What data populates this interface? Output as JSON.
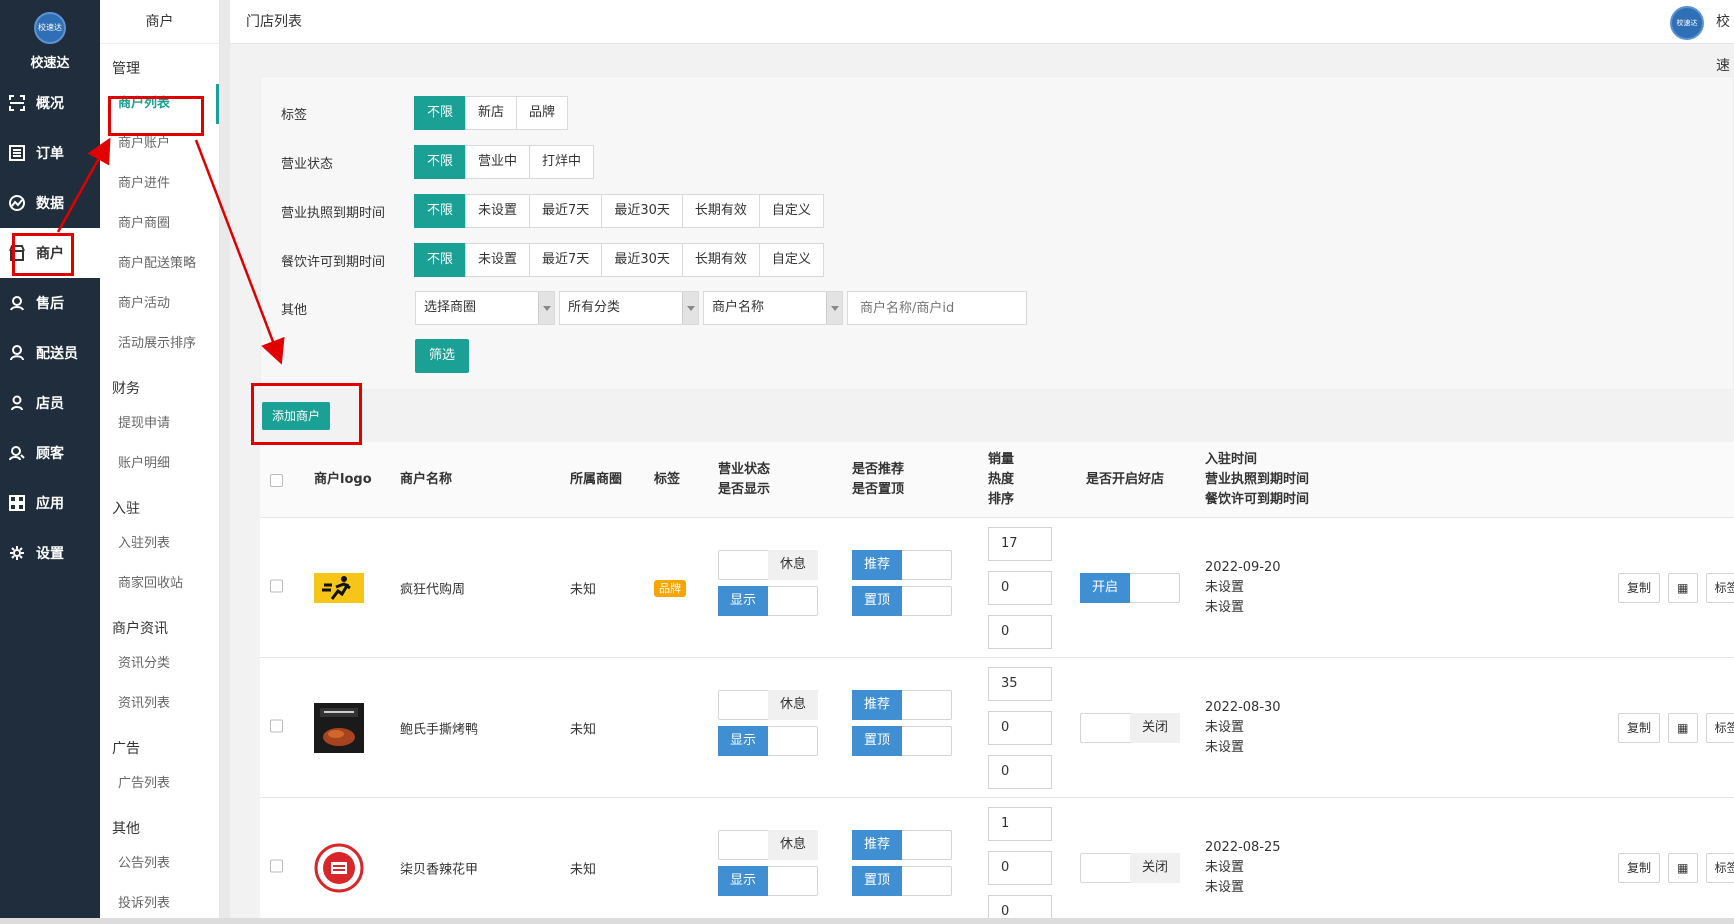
{
  "brand": {
    "logo_text": "校速达",
    "name": "校速达"
  },
  "nav": [
    {
      "label": "概况",
      "icon": "scan-icon"
    },
    {
      "label": "订单",
      "icon": "list-icon"
    },
    {
      "label": "数据",
      "icon": "chart-icon"
    },
    {
      "label": "商户",
      "icon": "store-icon"
    },
    {
      "label": "售后",
      "icon": "headset-icon"
    },
    {
      "label": "配送员",
      "icon": "user-icon"
    },
    {
      "label": "店员",
      "icon": "person-icon"
    },
    {
      "label": "顾客",
      "icon": "customer-icon"
    },
    {
      "label": "应用",
      "icon": "apps-icon"
    },
    {
      "label": "设置",
      "icon": "gear-icon"
    }
  ],
  "submenu": {
    "title": "商户",
    "groups": [
      {
        "label": "管理"
      },
      {
        "label": "财务"
      },
      {
        "label": "入驻"
      },
      {
        "label": "商户资讯"
      },
      {
        "label": "广告"
      },
      {
        "label": "其他"
      }
    ],
    "items": [
      "商户列表",
      "商户账户",
      "商户进件",
      "商户商圈",
      "商户配送策略",
      "商户活动",
      "活动展示排序",
      "提现申请",
      "账户明细",
      "入驻列表",
      "商家回收站",
      "资讯分类",
      "资讯列表",
      "广告列表",
      "公告列表",
      "投诉列表"
    ]
  },
  "header": {
    "title": "门店列表",
    "avatar_text": "校速达",
    "user": "校速"
  },
  "filters": {
    "tag": {
      "label": "标签",
      "options": [
        "不限",
        "新店",
        "品牌"
      ]
    },
    "status": {
      "label": "营业状态",
      "options": [
        "不限",
        "营业中",
        "打烊中"
      ]
    },
    "license": {
      "label": "营业执照到期时间",
      "options": [
        "不限",
        "未设置",
        "最近7天",
        "最近30天",
        "长期有效",
        "自定义"
      ]
    },
    "food": {
      "label": "餐饮许可到期时间",
      "options": [
        "不限",
        "未设置",
        "最近7天",
        "最近30天",
        "长期有效",
        "自定义"
      ]
    },
    "other": {
      "label": "其他",
      "select1": "选择商圈",
      "select2": "所有分类",
      "select3": "商户名称",
      "search_placeholder": "商户名称/商户id"
    },
    "submit": "筛选"
  },
  "add_button": "添加商户",
  "table": {
    "headers": {
      "logo": "商户logo",
      "name": "商户名称",
      "area": "所属商圈",
      "tag": "标签",
      "status1": "营业状态",
      "status2": "是否显示",
      "rec1": "是否推荐",
      "rec2": "是否置顶",
      "num1": "销量",
      "num2": "热度",
      "num3": "排序",
      "good": "是否开启好店",
      "date1": "入驻时间",
      "date2": "营业执照到期时间",
      "date3": "餐饮许可到期时间"
    },
    "rows": [
      {
        "name": "疯狂代购周",
        "area": "未知",
        "tag": "品牌",
        "rest": "休息",
        "show": "显示",
        "recommend": "推荐",
        "top": "置顶",
        "sales": "17",
        "heat": "0",
        "sort": "0",
        "good": "开启",
        "good_on": true,
        "joined": "2022-09-20",
        "license": "未设置",
        "food": "未设置",
        "op_copy": "复制",
        "op_tag": "标签"
      },
      {
        "name": "鲍氏手撕烤鸭",
        "area": "未知",
        "tag": "",
        "rest": "休息",
        "show": "显示",
        "recommend": "推荐",
        "top": "置顶",
        "sales": "35",
        "heat": "0",
        "sort": "0",
        "good": "关闭",
        "good_on": false,
        "joined": "2022-08-30",
        "license": "未设置",
        "food": "未设置",
        "op_copy": "复制",
        "op_tag": "标签"
      },
      {
        "name": "柒贝香辣花甲",
        "area": "未知",
        "tag": "",
        "rest": "休息",
        "show": "显示",
        "recommend": "推荐",
        "top": "置顶",
        "sales": "1",
        "heat": "0",
        "sort": "0",
        "good": "关闭",
        "good_on": false,
        "joined": "2022-08-25",
        "license": "未设置",
        "food": "未设置",
        "op_copy": "复制",
        "op_tag": "标签"
      }
    ]
  },
  "colors": {
    "primary": "#1aa094",
    "blue": "#3f8fd2",
    "nav_bg": "#1f2d3d",
    "annotation": "#e00000",
    "brand_tag": "#f7a500"
  }
}
